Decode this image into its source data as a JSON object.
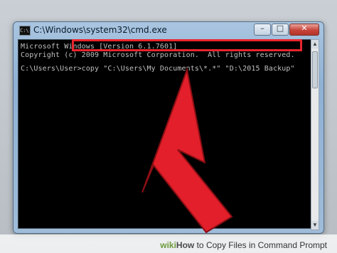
{
  "window": {
    "title": "C:\\Windows\\system32\\cmd.exe",
    "icon": "console-icon",
    "buttons": {
      "minimize": "–",
      "maximize": "□",
      "close": "✕"
    }
  },
  "console": {
    "lines": [
      "Microsoft Windows [Version 6.1.7601]",
      "Copyright (c) 2009 Microsoft Corporation.  All rights reserved.",
      "C:\\Users\\User>copy \"C:\\Users\\My Documents\\*.*\" \"D:\\2015 Backup\""
    ],
    "prompt": "C:\\Users\\User>",
    "command": "copy \"C:\\Users\\My Documents\\*.*\" \"D:\\2015 Backup\""
  },
  "annotation": {
    "highlight_color": "#e8262e",
    "arrow_color": "#e21f2a"
  },
  "footer": {
    "brand_a": "wiki",
    "brand_b": "How",
    "text": " to Copy Files in Command Prompt"
  }
}
